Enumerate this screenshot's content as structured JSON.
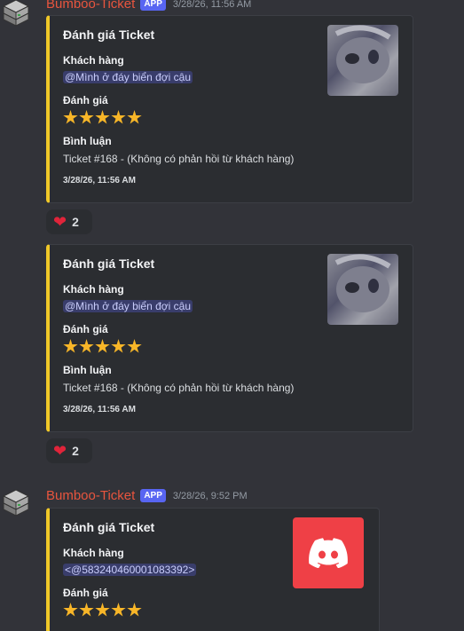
{
  "messages": [
    {
      "author": "Bumboo-Ticket",
      "badge": "APP",
      "timestamp": "3/28/26, 11:56 AM",
      "embeds": [
        {
          "title": "Đánh giá Ticket",
          "customer_label": "Khách hàng",
          "customer_value": "@Mình ở đáy biển đợi cậu",
          "rating_label": "Đánh giá",
          "rating": 5,
          "comment_label": "Bình luận",
          "comment_value": "Ticket #168 - (Không có phản hồi từ khách hàng)",
          "footer": "3/28/26, 11:56 AM",
          "reaction_count": "2"
        },
        {
          "title": "Đánh giá Ticket",
          "customer_label": "Khách hàng",
          "customer_value": "@Mình ở đáy biển đợi cậu",
          "rating_label": "Đánh giá",
          "rating": 5,
          "comment_label": "Bình luận",
          "comment_value": "Ticket #168 - (Không có phản hồi từ khách hàng)",
          "footer": "3/28/26, 11:56 AM",
          "reaction_count": "2"
        }
      ]
    },
    {
      "author": "Bumboo-Ticket",
      "badge": "APP",
      "timestamp": "3/28/26, 9:52 PM",
      "embeds": [
        {
          "title": "Đánh giá Ticket",
          "customer_label": "Khách hàng",
          "customer_value": "<@583240460001083392>",
          "rating_label": "Đánh giá",
          "rating": 5
        }
      ]
    }
  ],
  "colors": {
    "accent_bar": "#f0c828",
    "author": "#e8553e",
    "badge": "#5865f2",
    "star": "#f8b628",
    "discord_thumb": "#ef4046"
  },
  "icons": {
    "reaction": "heart-icon",
    "avatar": "server-stack-icon",
    "thumbnail_3": "discord-logo-icon"
  }
}
